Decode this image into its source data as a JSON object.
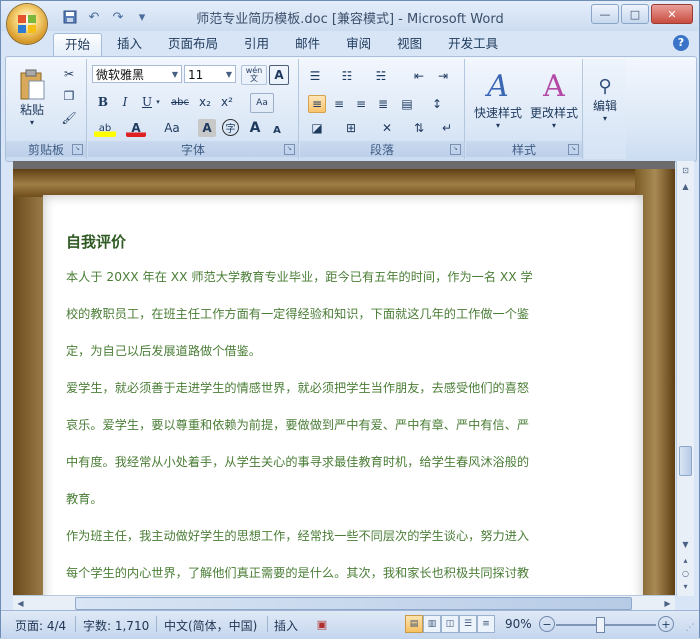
{
  "window": {
    "title": "师范专业简历模板.doc [兼容模式] - Microsoft Word"
  },
  "qat": {
    "save_icon": "save-icon",
    "undo_icon": "undo-icon",
    "redo_icon": "redo-icon",
    "more": "▾"
  },
  "tabs": [
    {
      "label": "开始"
    },
    {
      "label": "插入"
    },
    {
      "label": "页面布局"
    },
    {
      "label": "引用"
    },
    {
      "label": "邮件"
    },
    {
      "label": "审阅"
    },
    {
      "label": "视图"
    },
    {
      "label": "开发工具"
    }
  ],
  "ribbon": {
    "clipboard": {
      "label": "剪贴板",
      "paste": "粘贴"
    },
    "font": {
      "label": "字体",
      "font_name": "微软雅黑",
      "font_size": "11",
      "wen": "wén\n文",
      "A": "A",
      "bold": "B",
      "italic": "I",
      "underline": "U",
      "strike": "abc",
      "sub": "x₂",
      "sup": "x²",
      "clear": "Aa",
      "grow": "A",
      "shrink": "A",
      "case": "Aa",
      "shade": "A",
      "enclose": "字"
    },
    "paragraph": {
      "label": "段落"
    },
    "styles": {
      "label": "样式",
      "quick": "快速样式",
      "change": "更改样式"
    },
    "editing": {
      "label": "编辑"
    }
  },
  "document": {
    "heading": "自我评价",
    "lines": [
      "本人于 20XX 年在 XX 师范大学教育专业毕业，距今已有五年的时间，作为一名 XX 学",
      "校的教职员工，在班主任工作方面有一定得经验和知识，下面就这几年的工作做一个鉴",
      "定，为自己以后发展道路做个借鉴。",
      "爱学生，就必须善于走进学生的情感世界，就必须把学生当作朋友，去感受他们的喜怒",
      "哀乐。爱学生，要以尊重和依赖为前提，要做做到严中有爱、严中有章、严中有信、严",
      "中有度。我经常从小处着手，从学生关心的事寻求最佳教育时机，给学生春风沐浴般的",
      "教育。",
      "作为班主任，我主动做好学生的思想工作，经常找一些不同层次的学生谈心，努力进入",
      "每个学生的内心世界，了解他们真正需要的是什么。其次，我和家长也积极共同探讨教"
    ]
  },
  "status": {
    "page": "页面: 4/4",
    "words": "字数: 1,710",
    "lang": "中文(简体，中国)",
    "mode": "插入",
    "zoom": "90%",
    "zoom_value": 90
  }
}
